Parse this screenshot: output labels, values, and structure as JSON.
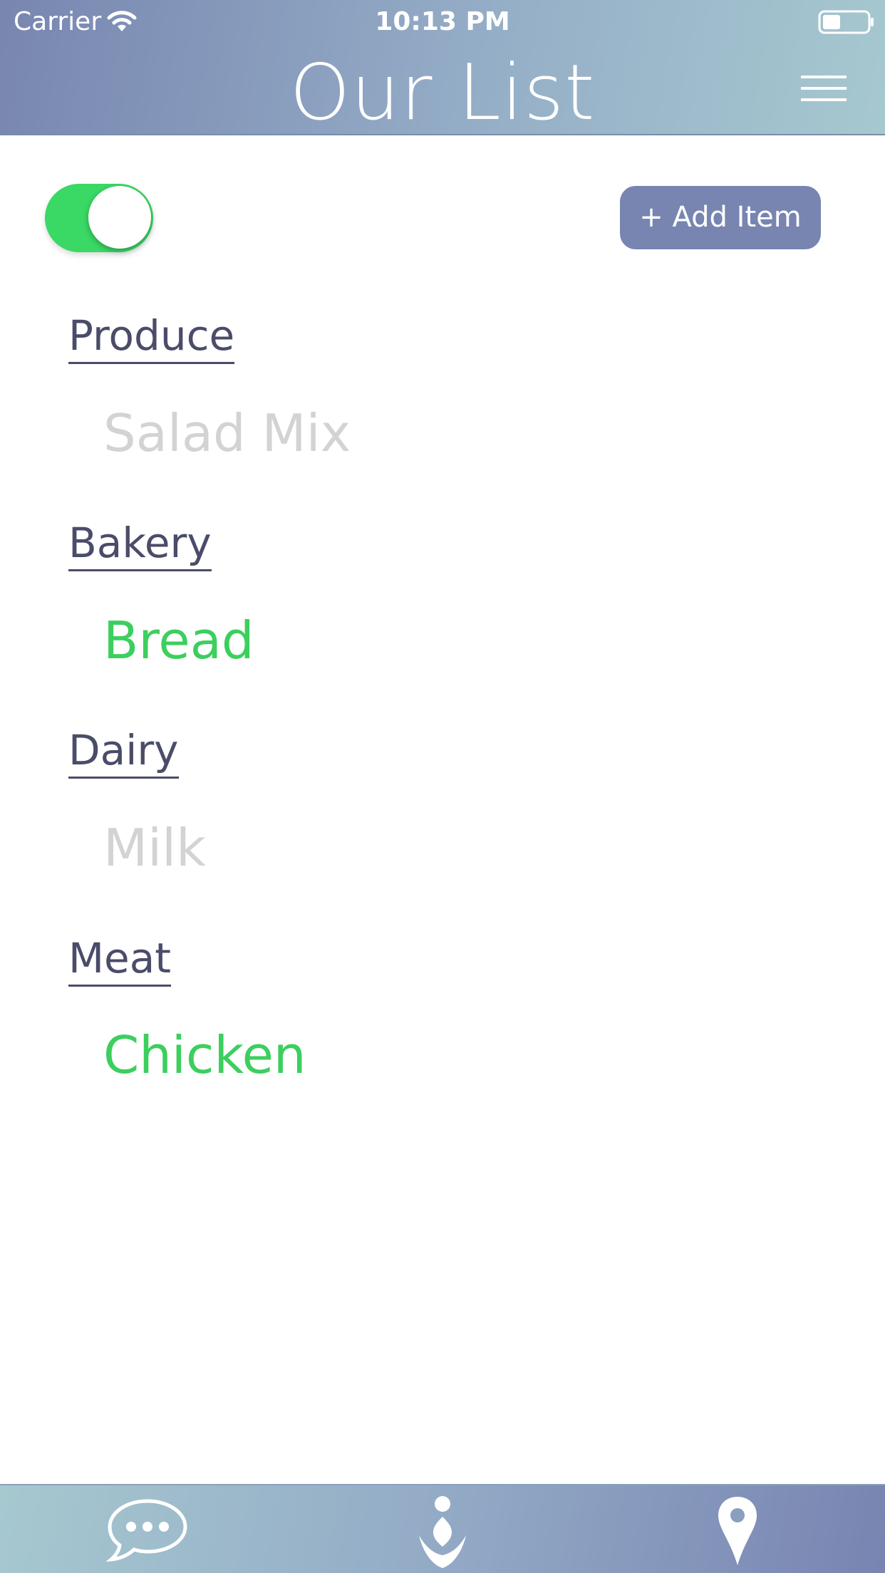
{
  "status": {
    "carrier": "Carrier",
    "time": "10:13 PM",
    "battery_level": 0.4
  },
  "header": {
    "title": "Our List",
    "menu_icon": "hamburger-menu-icon"
  },
  "controls": {
    "toggle_on": true,
    "add_item_label": "+ Add Item"
  },
  "list": [
    {
      "category": "Produce",
      "item": "Salad Mix",
      "checked": true
    },
    {
      "category": "Bakery",
      "item": "Bread",
      "checked": false
    },
    {
      "category": "Dairy",
      "item": "Milk",
      "checked": true
    },
    {
      "category": "Meat",
      "item": "Chicken",
      "checked": false
    }
  ],
  "tabbar": {
    "tabs": [
      "chat-bubble-icon",
      "person-logo-icon",
      "location-pin-icon"
    ]
  },
  "colors": {
    "header_start": "#7886b0",
    "header_end": "#a6c8cf",
    "accent_green": "#3ad864",
    "button": "#7885b0",
    "category_text": "#4a4c6a",
    "checked_item": "#d3d3d3"
  }
}
